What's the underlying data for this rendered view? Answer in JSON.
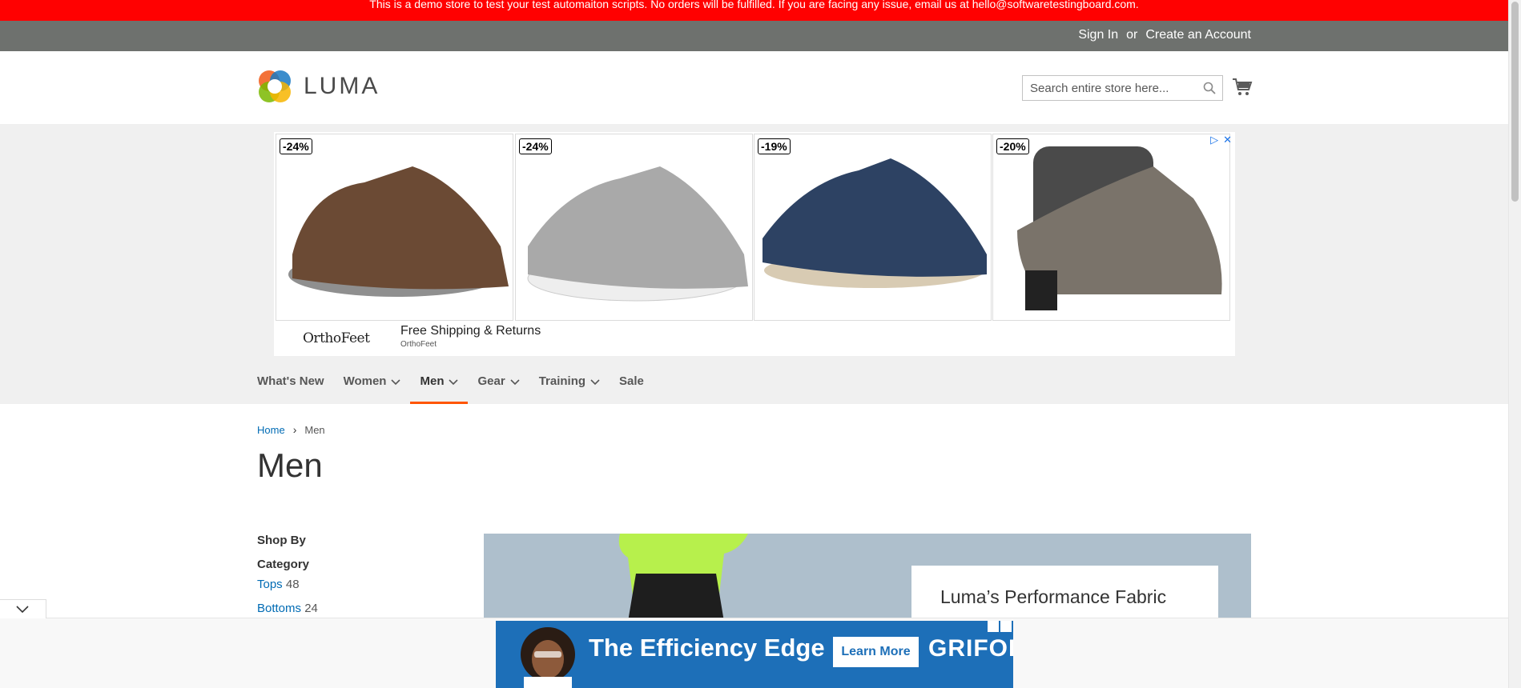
{
  "demo_notice": "This is a demo store to test your test automaiton scripts. No orders will be fulfilled. If you are facing any issue, email us at hello@softwaretestingboard.com.",
  "topbar": {
    "sign_in": "Sign In",
    "or": "or",
    "create_account": "Create an Account"
  },
  "header": {
    "logo_text": "LUMA",
    "search_placeholder": "Search entire store here...",
    "icons": {
      "search": "search-icon",
      "cart": "cart-icon"
    }
  },
  "ad": {
    "cards": [
      {
        "discount": "-24%",
        "shoe_color": "#6b4a34"
      },
      {
        "discount": "-24%",
        "shoe_color": "#a9a9a9"
      },
      {
        "discount": "-19%",
        "shoe_color": "#2d4263"
      },
      {
        "discount": "-20%",
        "shoe_color": "#7a736a"
      }
    ],
    "advertiser_logo": "OrthoFeet",
    "headline": "Free Shipping & Returns",
    "advertiser": "OrthoFeet"
  },
  "nav": {
    "items": [
      {
        "label": "What's New",
        "has_dropdown": false
      },
      {
        "label": "Women",
        "has_dropdown": true
      },
      {
        "label": "Men",
        "has_dropdown": true,
        "active": true
      },
      {
        "label": "Gear",
        "has_dropdown": true
      },
      {
        "label": "Training",
        "has_dropdown": true
      },
      {
        "label": "Sale",
        "has_dropdown": false
      }
    ],
    "accent_color": "#ff5501"
  },
  "breadcrumb": {
    "home": "Home",
    "current": "Men"
  },
  "page_title": "Men",
  "sidebar": {
    "shop_by": "Shop By",
    "category_title": "Category",
    "categories": [
      {
        "label": "Tops",
        "count": "48"
      },
      {
        "label": "Bottoms",
        "count": "24"
      }
    ]
  },
  "hero": {
    "title": "Luma’s Performance Fabric"
  },
  "bottom_ad": {
    "headline": "The Efficiency Edge",
    "cta": "Learn More",
    "brand": "GRIFOLS"
  }
}
